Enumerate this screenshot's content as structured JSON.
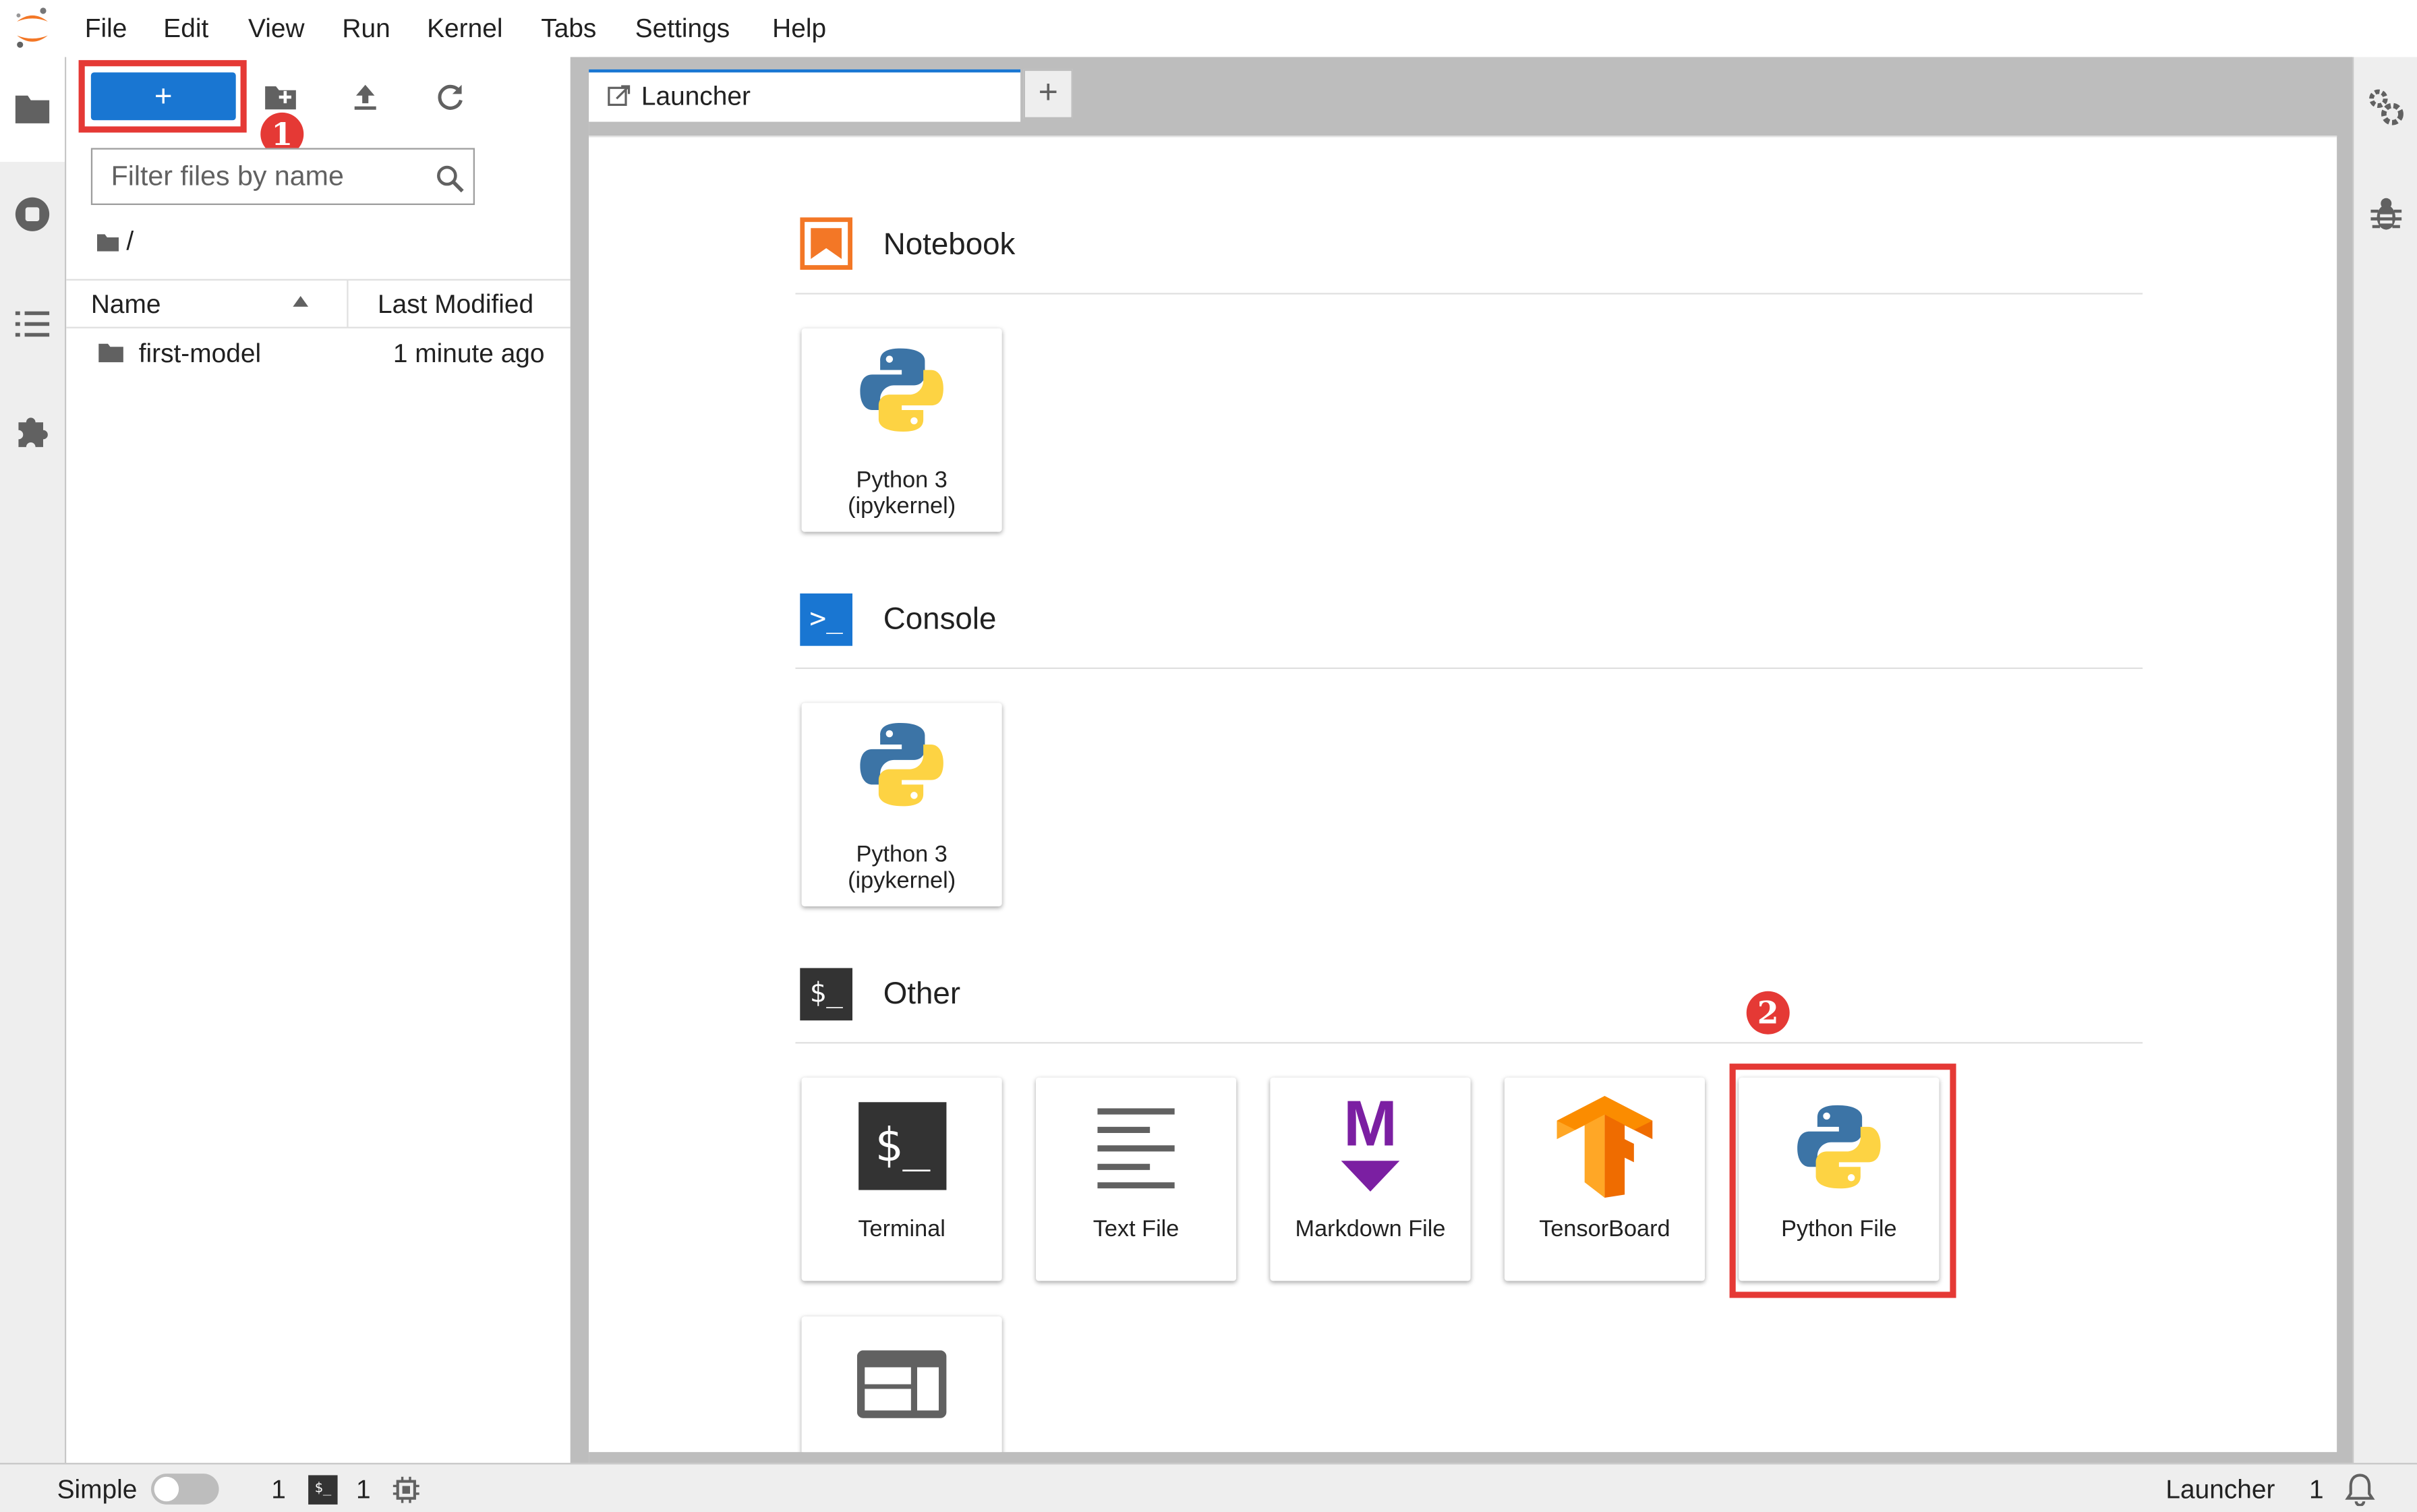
{
  "menubar": {
    "items": [
      "File",
      "Edit",
      "View",
      "Run",
      "Kernel",
      "Tabs",
      "Settings",
      "Help"
    ]
  },
  "activity_bar": {
    "icons": [
      "folder-icon",
      "running-icon",
      "toc-icon",
      "extensions-icon"
    ]
  },
  "file_browser": {
    "new_launcher_label": "+",
    "filter_placeholder": "Filter files by name",
    "breadcrumb": "/",
    "columns": {
      "name": "Name",
      "modified": "Last Modified"
    },
    "rows": [
      {
        "name": "first-model",
        "modified": "1 minute ago",
        "type": "folder"
      }
    ]
  },
  "annotations": {
    "badge1": "1",
    "badge2": "2"
  },
  "tabs": {
    "items": [
      {
        "label": "Launcher"
      }
    ],
    "add_label": "+"
  },
  "launcher": {
    "sections": {
      "notebook": {
        "title": "Notebook",
        "cards": [
          {
            "label_line1": "Python 3",
            "label_line2": "(ipykernel)"
          }
        ]
      },
      "console": {
        "title": "Console",
        "icon_text": ">_",
        "cards": [
          {
            "label_line1": "Python 3",
            "label_line2": "(ipykernel)"
          }
        ]
      },
      "other": {
        "title": "Other",
        "icon_text": "$_",
        "cards": [
          {
            "label": "Terminal",
            "icon_text": "$_"
          },
          {
            "label": "Text File"
          },
          {
            "label": "Markdown File",
            "icon_text": "M"
          },
          {
            "label": "TensorBoard"
          },
          {
            "label": "Python File"
          }
        ]
      }
    }
  },
  "statusbar": {
    "mode_label": "Simple",
    "kernels_count": "1",
    "terminal_icon_text": "$_",
    "terminals_count": "1",
    "active_label": "Launcher",
    "notifications_count": "1"
  },
  "colors": {
    "accent": "#1976d2",
    "highlight": "#e53935",
    "notebook_orange": "#f37726",
    "console_blue": "#1976d2",
    "markdown_purple": "#7b1fa2",
    "tensorboard_orange": "#f57c00"
  }
}
